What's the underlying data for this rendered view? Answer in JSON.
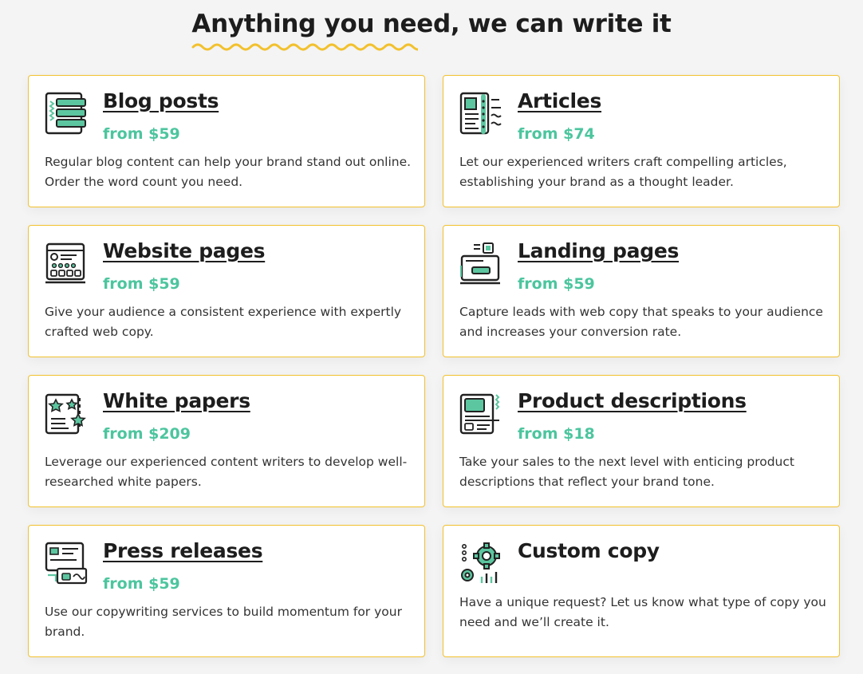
{
  "heading": "Anything you need, we can write it",
  "colors": {
    "accent_border": "#f2c12e",
    "price_green": "#4cc59e",
    "icon_green": "#5cc6a0",
    "squiggle": "#f2c12e"
  },
  "services": [
    {
      "title": "Blog posts",
      "price": "from $59",
      "description": "Regular blog content can help your brand stand out online. Order the word count you need.",
      "icon": "blog-posts-icon"
    },
    {
      "title": "Articles",
      "price": "from $74",
      "description": "Let our experienced writers craft compelling articles, establishing your brand as a thought leader.",
      "icon": "articles-icon"
    },
    {
      "title": "Website pages",
      "price": "from $59",
      "description": "Give your audience a consistent experience with expertly crafted web copy.",
      "icon": "website-pages-icon"
    },
    {
      "title": "Landing pages",
      "price": "from $59",
      "description": "Capture leads with web copy that speaks to your audience and increases your conversion rate.",
      "icon": "landing-pages-icon"
    },
    {
      "title": "White papers",
      "price": "from $209",
      "description": "Leverage our experienced content writers to develop well-researched white papers.",
      "icon": "white-papers-icon"
    },
    {
      "title": "Product descriptions",
      "price": "from $18",
      "description": "Take your sales to the next level with enticing product descriptions that reflect your brand tone.",
      "icon": "product-descriptions-icon"
    },
    {
      "title": "Press releases",
      "price": "from $59",
      "description": "Use our copywriting services to build momentum for your brand.",
      "icon": "press-releases-icon"
    },
    {
      "title": "Custom copy",
      "description": "Have a unique request? Let us know what type of copy you need and we’ll create it.",
      "icon": "gear-icon"
    }
  ]
}
